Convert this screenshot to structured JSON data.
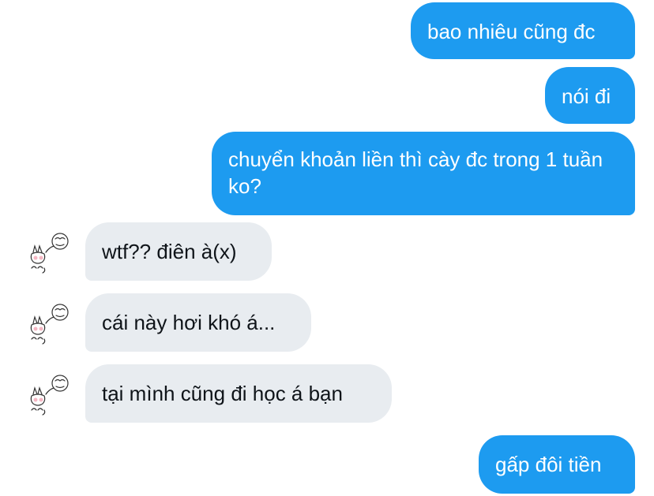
{
  "messages": [
    {
      "direction": "outgoing",
      "text": "bao nhiêu cũng đc"
    },
    {
      "direction": "outgoing",
      "text": "nói đi"
    },
    {
      "direction": "outgoing",
      "text": "chuyển khoản liền thì cày đc trong 1 tuần ko?"
    },
    {
      "direction": "incoming",
      "text": "wtf?? điên à(x)",
      "avatar_icon": "doodle-avatar-icon"
    },
    {
      "direction": "incoming",
      "text": "cái này hơi khó á...",
      "avatar_icon": "doodle-avatar-icon"
    },
    {
      "direction": "incoming",
      "text": "tại mình cũng đi học á bạn",
      "avatar_icon": "doodle-avatar-icon"
    },
    {
      "direction": "outgoing",
      "text": "gấp đôi tiền"
    }
  ],
  "colors": {
    "outgoing_bubble": "#1d9bf0",
    "incoming_bubble": "#e8ecf0",
    "outgoing_text": "#ffffff",
    "incoming_text": "#0f1419"
  }
}
